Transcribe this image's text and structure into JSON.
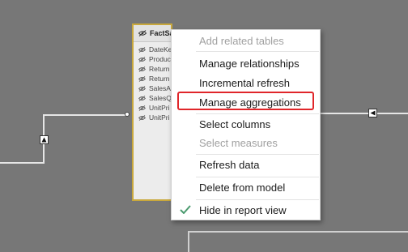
{
  "table": {
    "name": "FactSal",
    "header_icon": "eye-hidden-icon",
    "fields": [
      "DateKe",
      "Produc",
      "Return",
      "Return",
      "SalesA",
      "SalesQ",
      "UnitPri",
      "UnitPri"
    ]
  },
  "context_menu": {
    "items": [
      {
        "label": "Add related tables",
        "enabled": false
      },
      {
        "label": "Manage relationships",
        "enabled": true
      },
      {
        "label": "Incremental refresh",
        "enabled": true
      },
      {
        "label": "Manage aggregations",
        "enabled": true,
        "highlighted": true
      },
      {
        "label": "Select columns",
        "enabled": true
      },
      {
        "label": "Select measures",
        "enabled": false
      },
      {
        "label": "Refresh data",
        "enabled": true
      },
      {
        "label": "Delete from model",
        "enabled": true
      },
      {
        "label": "Hide in report view",
        "enabled": true,
        "checked": true
      }
    ]
  },
  "colors": {
    "canvas": "#777777",
    "table_border": "#c9a83c",
    "highlight": "#e0262a",
    "check": "#4a9a6e",
    "disabled_text": "#a0a0a0"
  }
}
